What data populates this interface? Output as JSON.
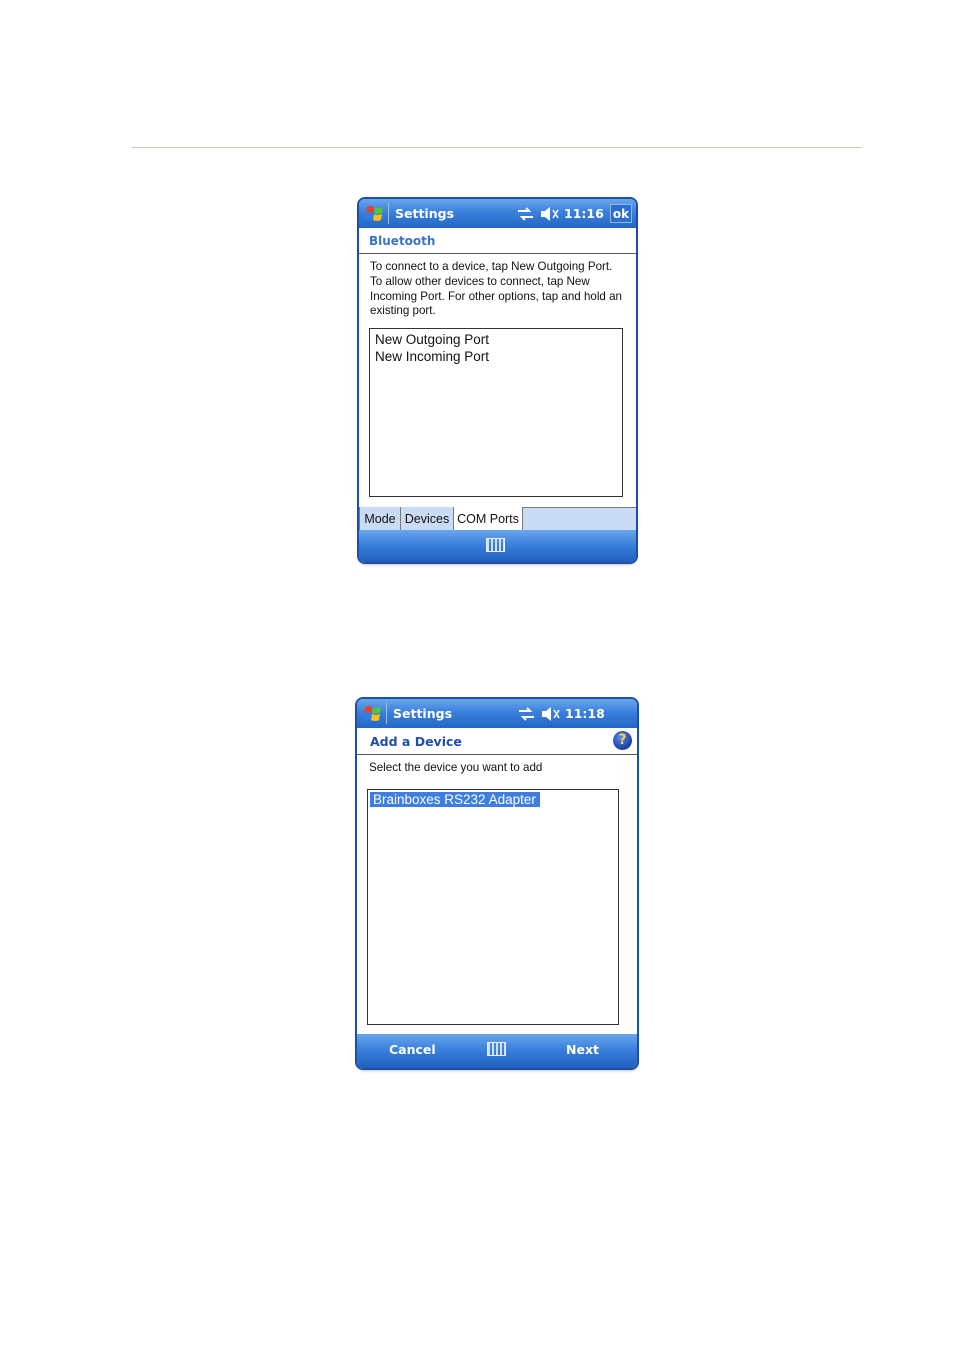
{
  "screen1": {
    "title": "Settings",
    "time": "11:16",
    "ok_label": "ok",
    "heading": "Bluetooth",
    "instructions": "To connect to a device, tap New Outgoing Port. To allow other devices to connect, tap New Incoming Port. For other options, tap and hold an existing port.",
    "list_items": [
      "New Outgoing Port",
      "New Incoming Port"
    ],
    "tabs": [
      "Mode",
      "Devices",
      "COM Ports"
    ],
    "active_tab": "COM Ports",
    "icons": [
      "windows-start-icon",
      "connectivity-icon",
      "volume-muted-icon",
      "keyboard-icon"
    ]
  },
  "screen2": {
    "title": "Settings",
    "time": "11:18",
    "heading": "Add a Device",
    "help_glyph": "?",
    "prompt": "Select the device you want to add",
    "list_items": [
      "Brainboxes RS232 Adapter"
    ],
    "selected_item": "Brainboxes RS232 Adapter",
    "softkey_left": "Cancel",
    "softkey_right": "Next",
    "icons": [
      "windows-start-icon",
      "connectivity-icon",
      "volume-muted-icon",
      "help-icon",
      "keyboard-icon"
    ]
  },
  "colors": {
    "titlebar": "#3a80dc",
    "heading_text": "#3a74c8",
    "selection": "#3d7ee0",
    "tab_strip": "#c9dbf5"
  }
}
